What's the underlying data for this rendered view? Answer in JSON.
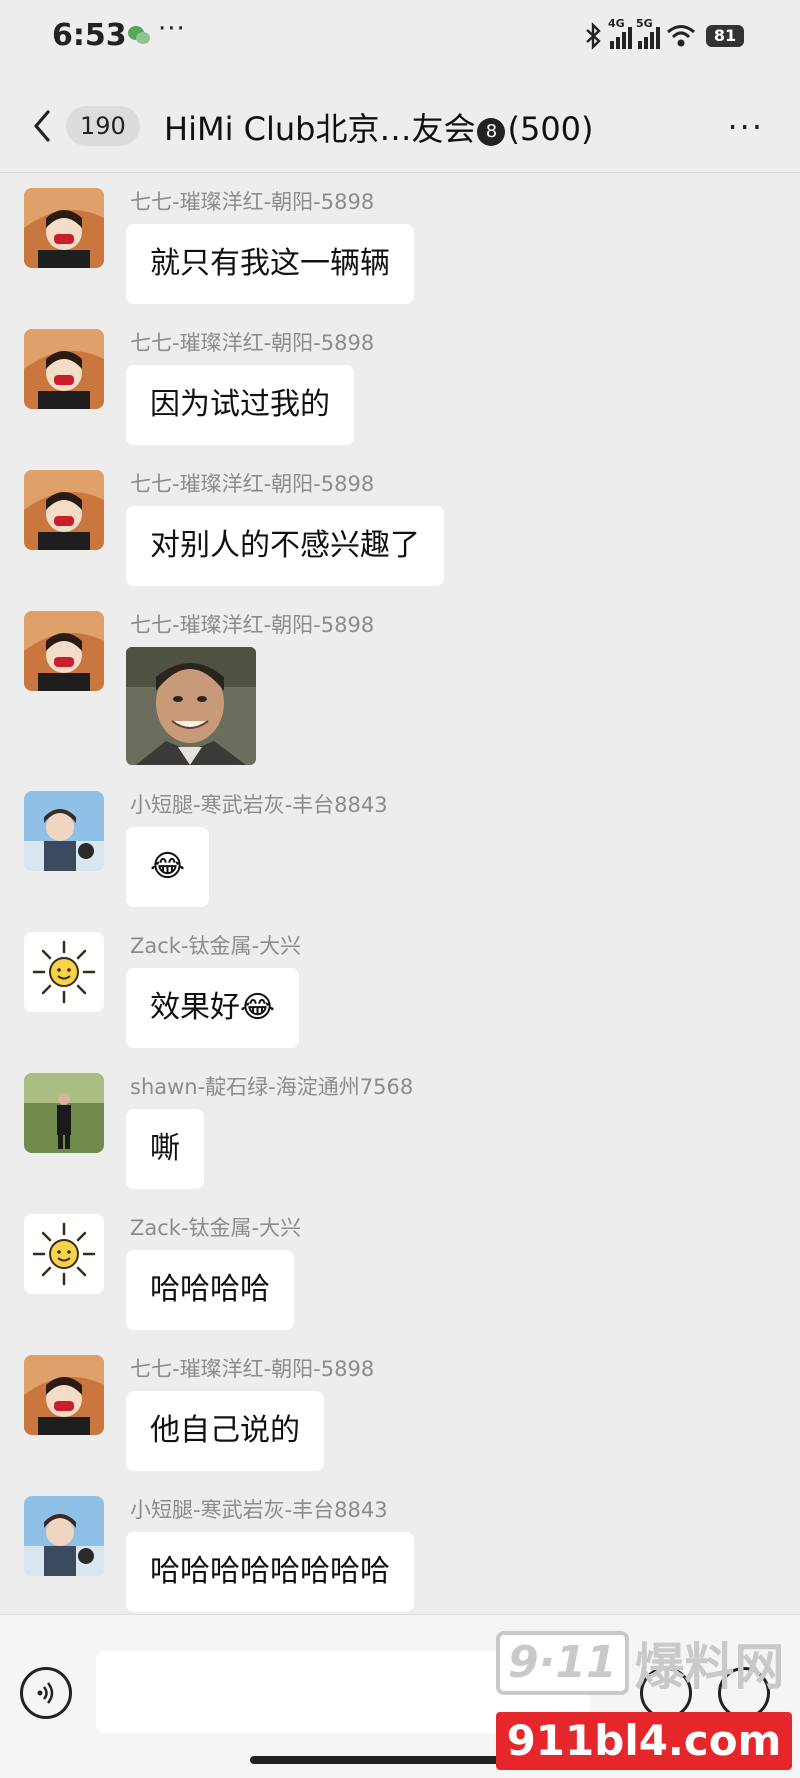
{
  "status_bar": {
    "time": "6:53",
    "more": "···",
    "signal1_label": "4G",
    "signal2_label": "5G",
    "battery": "81"
  },
  "header": {
    "unread_count": "190",
    "title": "HiMi Club北京…友会",
    "badge": "8",
    "member_count": "(500)",
    "more": "···"
  },
  "messages": [
    {
      "sender": "七七-璀璨洋红-朝阳-5898",
      "text": "就只有我这一辆辆",
      "avatar": "user-qiqi"
    },
    {
      "sender": "七七-璀璨洋红-朝阳-5898",
      "text": "因为试过我的",
      "avatar": "user-qiqi"
    },
    {
      "sender": "七七-璀璨洋红-朝阳-5898",
      "text": "对别人的不感兴趣了",
      "avatar": "user-qiqi"
    },
    {
      "sender": "七七-璀璨洋红-朝阳-5898",
      "sticker": "smiling-man-sticker",
      "avatar": "user-qiqi"
    },
    {
      "sender": "小短腿-寒武岩灰-丰台8843",
      "text": "😂",
      "avatar": "user-xiaoduantui"
    },
    {
      "sender": "Zack-钛金属-大兴",
      "text": "效果好😂",
      "avatar": "user-zack"
    },
    {
      "sender": "shawn-靛石绿-海淀通州7568",
      "text": "嘶",
      "avatar": "user-shawn"
    },
    {
      "sender": "Zack-钛金属-大兴",
      "text": "哈哈哈哈",
      "avatar": "user-zack"
    },
    {
      "sender": "七七-璀璨洋红-朝阳-5898",
      "text": "他自己说的",
      "avatar": "user-qiqi"
    },
    {
      "sender": "小短腿-寒武岩灰-丰台8843",
      "text": "哈哈哈哈哈哈哈哈",
      "avatar": "user-xiaoduantui"
    }
  ],
  "watermark": {
    "logo_num": "9·11",
    "logo_cn": "爆料网",
    "url": "911bl4.com"
  },
  "colors": {
    "background": "#ededed",
    "bubble": "#ffffff",
    "sender_text": "#8c8c8c",
    "watermark_red": "#e5262a"
  }
}
